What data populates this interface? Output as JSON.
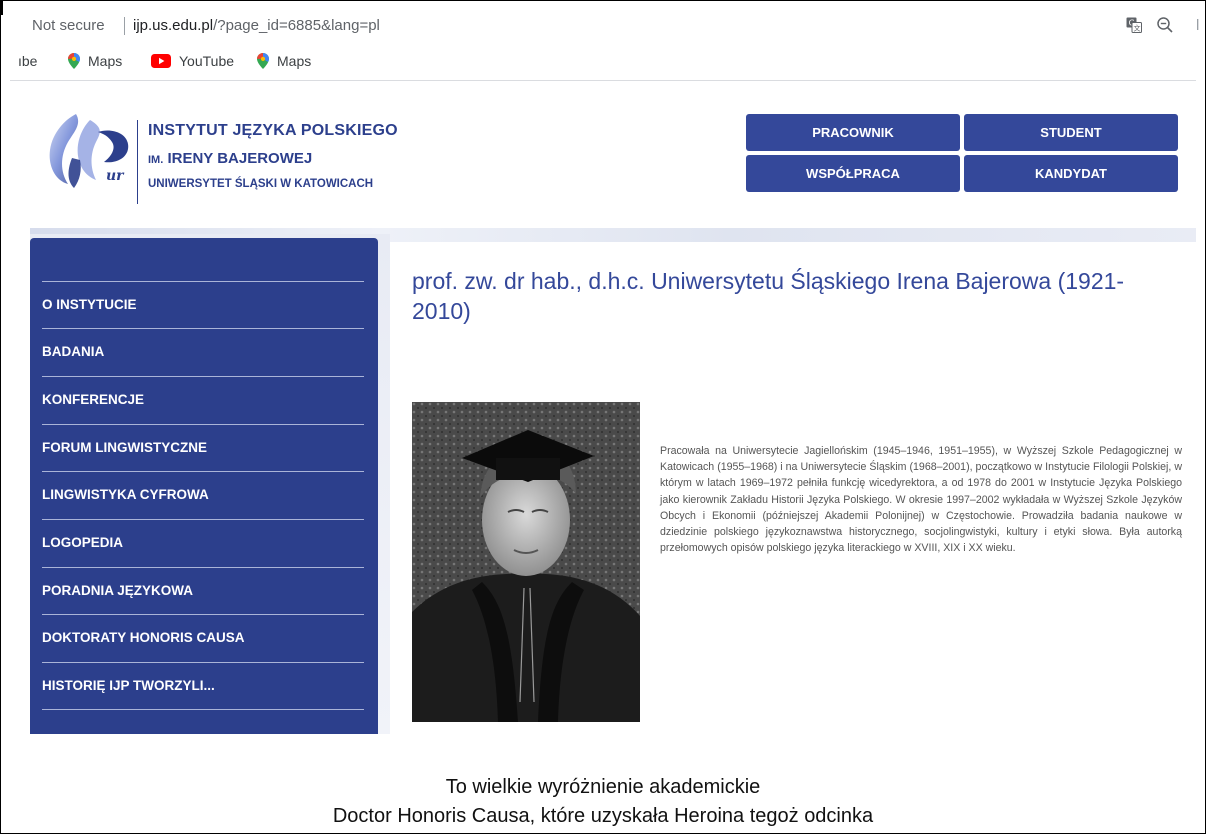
{
  "browser": {
    "not_secure": "Not secure",
    "url_host": "ijp.us.edu.pl",
    "url_path": "/?page_id=6885&lang=pl",
    "trailing_char": "l",
    "icons": [
      "translate-icon",
      "zoom-out-icon"
    ]
  },
  "bookmarks": [
    {
      "label": "ıbe",
      "icon": ""
    },
    {
      "label": "Maps",
      "icon": "maps-pin-icon"
    },
    {
      "label": "YouTube",
      "icon": "youtube-icon"
    },
    {
      "label": "Maps",
      "icon": "maps-pin-icon"
    }
  ],
  "site": {
    "logo_line1": "INSTYTUT JĘZYKA POLSKIEGO",
    "logo_line2_prefix": "IM.",
    "logo_line2": "IRENY BAJEROWEJ",
    "logo_line3": "UNIWERSYTET ŚLĄSKI W KATOWICACH",
    "top_nav": [
      "PRACOWNIK",
      "STUDENT",
      "WSPÓŁPRACA",
      "KANDYDAT"
    ]
  },
  "sidebar": {
    "items": [
      "O INSTYTUCIE",
      "BADANIA",
      "KONFERENCJE",
      "FORUM LINGWISTYCZNE",
      "LINGWISTYKA CYFROWA",
      "LOGOPEDIA",
      "PORADNIA JĘZYKOWA",
      "DOKTORATY HONORIS CAUSA",
      "HISTORIĘ IJP TWORZYLI..."
    ]
  },
  "main": {
    "title": "prof. zw. dr hab., d.h.c. Uniwersytetu Śląskiego Irena Bajerowa (1921-2010)",
    "bio": "Pracowała na Uniwersytecie Jagiellońskim (1945–1946, 1951–1955), w Wyższej Szkole Pedagogicznej w Katowicach (1955–1968) i na Uniwersytecie Śląskim (1968–2001), początkowo w Instytucie Filologii Polskiej, w którym w latach 1969–1972 pełniła funkcję wicedyrektora, a od 1978 do 2001 w Instytucie Języka Polskiego jako kierownik Zakładu Historii Języka Polskiego. W okresie 1997–2002 wykładała w Wyższej Szkole Języków Obcych i Ekonomii (późniejszej Akademii Polonijnej) w Częstochowie. Prowadziła badania naukowe w dziedzinie polskiego językoznawstwa historycznego, socjolingwistyki, kultury i etyki słowa. Była autorką przełomowych opisów polskiego języka literackiego w XVIII, XIX i XX wieku."
  },
  "caption": {
    "line1": "To wielkie wyróżnienie akademickie",
    "line2": "Doctor Honoris Causa, które uzyskała Heroina tegoż odcinka"
  },
  "colors": {
    "brand_blue": "#2c3f8c",
    "button_blue": "#34489a",
    "text_gray": "#555555"
  }
}
